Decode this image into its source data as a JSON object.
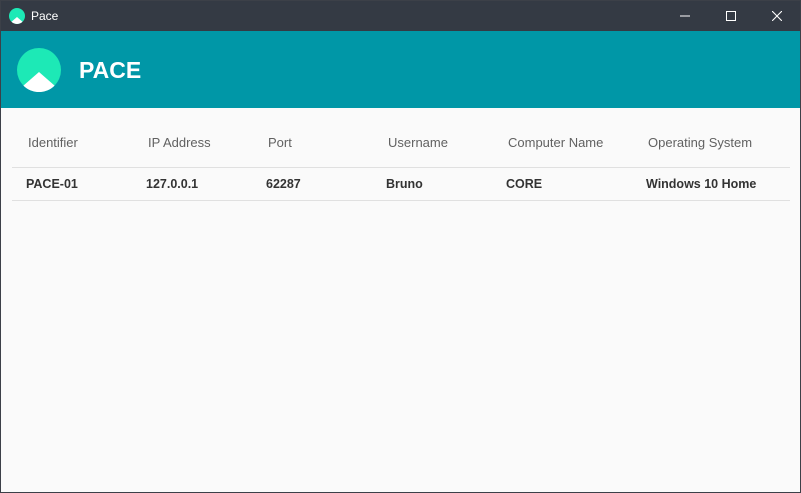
{
  "window": {
    "title": "Pace",
    "icon": "pace-logo-icon"
  },
  "header": {
    "brand": "PACE",
    "color": "#0097a7",
    "logo_icon": "pace-logo-icon"
  },
  "table": {
    "columns": [
      "Identifier",
      "IP Address",
      "Port",
      "Username",
      "Computer Name",
      "Operating System"
    ],
    "rows": [
      [
        "PACE-01",
        "127.0.0.1",
        "62287",
        "Bruno",
        "CORE",
        "Windows 10 Home"
      ]
    ]
  },
  "colors": {
    "titlebar": "#343a44",
    "accent": "#0097a7",
    "logo_circle": "#1de9b6",
    "background": "#fafafa"
  }
}
